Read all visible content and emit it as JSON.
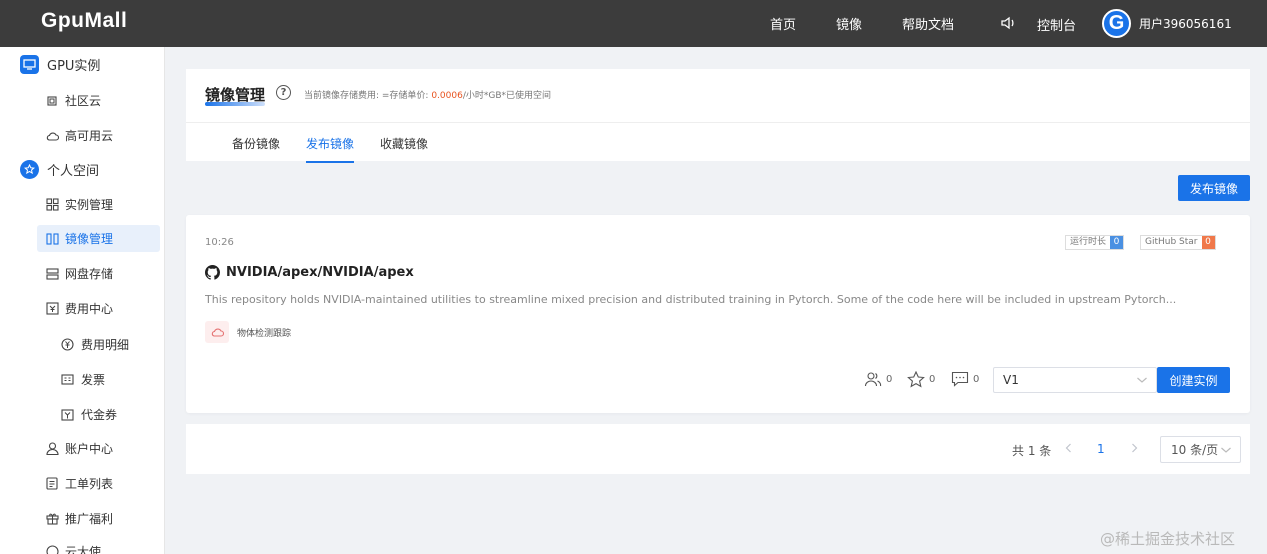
{
  "header": {
    "logo": "GpuMall",
    "nav": [
      "首页",
      "镜像",
      "帮助文档"
    ],
    "console": "控制台",
    "avatar_letter": "G",
    "username": "用户396056161"
  },
  "sidebar": {
    "group_gpu": "GPU实例",
    "item_community": "社区云",
    "item_ha": "高可用云",
    "group_personal": "个人空间",
    "item_instances": "实例管理",
    "item_images": "镜像管理",
    "item_storage": "网盘存储",
    "item_billing": "费用中心",
    "sub_billing_detail": "费用明细",
    "sub_invoice": "发票",
    "sub_voucher": "代金券",
    "item_account": "账户中心",
    "item_tickets": "工单列表",
    "item_promo": "推广福利",
    "item_more": "云大使"
  },
  "page": {
    "title": "镜像管理",
    "fee_prefix": "当前镜像存储费用: =存储单价: ",
    "fee_price": "0.0006",
    "fee_suffix": "/小时*GB*已使用空间",
    "tabs": [
      "备份镜像",
      "发布镜像",
      "收藏镜像"
    ],
    "active_tab": 1,
    "publish_button": "发布镜像"
  },
  "card": {
    "time": "10:26",
    "badge_runtime_label": "运行时长",
    "badge_runtime_value": "0",
    "badge_star_label": "GitHub Star",
    "badge_star_value": "0",
    "repo": "NVIDIA/apex/NVIDIA/apex",
    "description": "This repository holds NVIDIA-maintained utilities to streamline mixed precision and distributed training in Pytorch. Some of the code here will be included in upstream Pytorch...",
    "tag": "物体检测跟踪",
    "users_count": "0",
    "stars_count": "0",
    "comments_count": "0",
    "version": "V1",
    "create_button": "创建实例"
  },
  "pagination": {
    "total": "共 1 条",
    "current_page": "1",
    "page_size": "10 条/页"
  },
  "watermark": "@稀土掘金技术社区",
  "colors": {
    "accent": "#1a73e8",
    "topbar": "#3c3c3c",
    "price": "#e8531f",
    "badge_runtime": "#4a90e2",
    "badge_star": "#f0784a"
  }
}
